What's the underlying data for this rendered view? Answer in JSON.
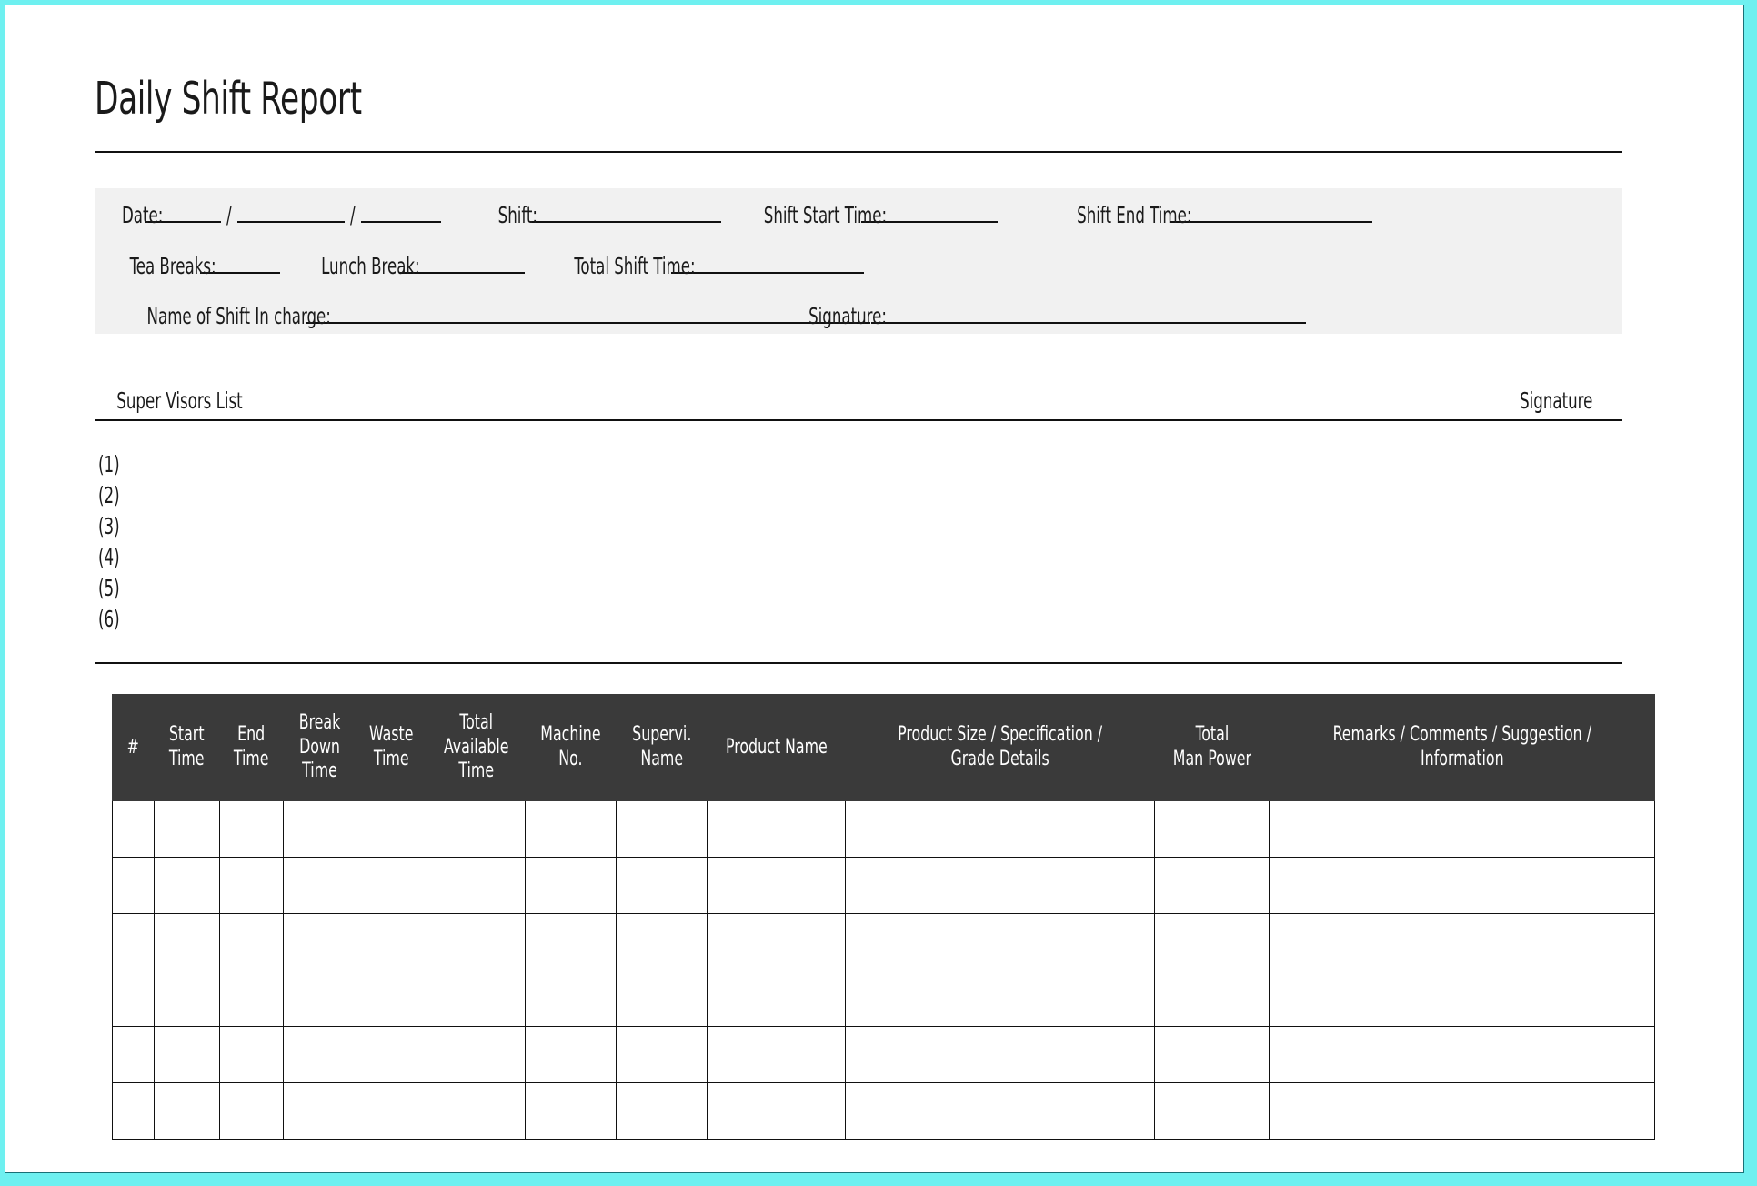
{
  "document": {
    "title": "Daily Shift Report",
    "frame_color": "#6ef0f0",
    "form_block_color": "#f1f1f1",
    "table_header_color": "#3a3a3a"
  },
  "form": {
    "date_label": "Date:",
    "date_sep_1": "/",
    "date_sep_2": "/",
    "shift_label": "Shift:",
    "shift_start_label": "Shift Start Time:",
    "shift_end_label": "Shift End Time:",
    "tea_breaks_label": "Tea Breaks:",
    "lunch_break_label": "Lunch Break:",
    "total_shift_time_label": "Total Shift Time:",
    "name_in_charge_label": "Name of Shift In charge:",
    "signature_label": "Signature:"
  },
  "supervisors": {
    "heading": "Super Visors List",
    "signature_heading": "Signature",
    "items": [
      "(1)",
      "(2)",
      "(3)",
      "(4)",
      "(5)",
      "(6)"
    ]
  },
  "table": {
    "columns": [
      "#",
      "Start\nTime",
      "End\nTime",
      "Break\nDown\nTime",
      "Waste\nTime",
      "Total\nAvailable\nTime",
      "Machine\nNo.",
      "Supervi.\nName",
      "Product Name",
      "Product Size / Specification /\nGrade Details",
      "Total\nMan Power",
      "Remarks / Comments / Suggestion /\nInformation"
    ],
    "row_count": 6,
    "rows": [
      [
        "",
        "",
        "",
        "",
        "",
        "",
        "",
        "",
        "",
        "",
        "",
        ""
      ],
      [
        "",
        "",
        "",
        "",
        "",
        "",
        "",
        "",
        "",
        "",
        "",
        ""
      ],
      [
        "",
        "",
        "",
        "",
        "",
        "",
        "",
        "",
        "",
        "",
        "",
        ""
      ],
      [
        "",
        "",
        "",
        "",
        "",
        "",
        "",
        "",
        "",
        "",
        "",
        ""
      ],
      [
        "",
        "",
        "",
        "",
        "",
        "",
        "",
        "",
        "",
        "",
        "",
        ""
      ],
      [
        "",
        "",
        "",
        "",
        "",
        "",
        "",
        "",
        "",
        "",
        "",
        ""
      ]
    ]
  }
}
